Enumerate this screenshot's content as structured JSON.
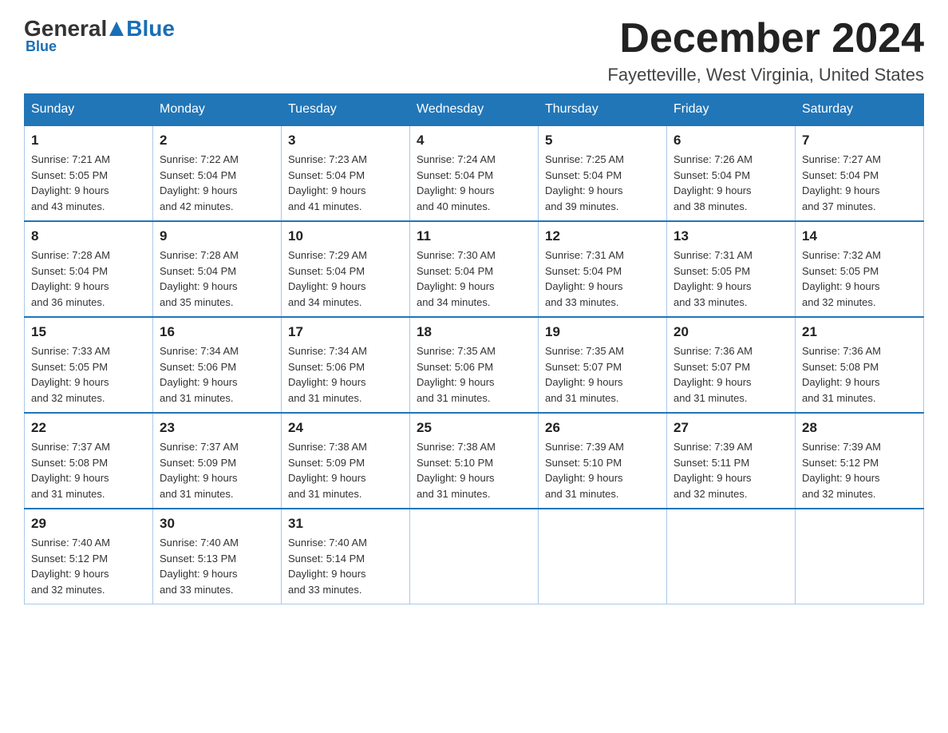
{
  "header": {
    "logo_general": "General",
    "logo_blue": "Blue",
    "month_title": "December 2024",
    "location": "Fayetteville, West Virginia, United States"
  },
  "days_of_week": [
    "Sunday",
    "Monday",
    "Tuesday",
    "Wednesday",
    "Thursday",
    "Friday",
    "Saturday"
  ],
  "weeks": [
    [
      {
        "day": "1",
        "sunrise": "7:21 AM",
        "sunset": "5:05 PM",
        "daylight": "9 hours and 43 minutes."
      },
      {
        "day": "2",
        "sunrise": "7:22 AM",
        "sunset": "5:04 PM",
        "daylight": "9 hours and 42 minutes."
      },
      {
        "day": "3",
        "sunrise": "7:23 AM",
        "sunset": "5:04 PM",
        "daylight": "9 hours and 41 minutes."
      },
      {
        "day": "4",
        "sunrise": "7:24 AM",
        "sunset": "5:04 PM",
        "daylight": "9 hours and 40 minutes."
      },
      {
        "day": "5",
        "sunrise": "7:25 AM",
        "sunset": "5:04 PM",
        "daylight": "9 hours and 39 minutes."
      },
      {
        "day": "6",
        "sunrise": "7:26 AM",
        "sunset": "5:04 PM",
        "daylight": "9 hours and 38 minutes."
      },
      {
        "day": "7",
        "sunrise": "7:27 AM",
        "sunset": "5:04 PM",
        "daylight": "9 hours and 37 minutes."
      }
    ],
    [
      {
        "day": "8",
        "sunrise": "7:28 AM",
        "sunset": "5:04 PM",
        "daylight": "9 hours and 36 minutes."
      },
      {
        "day": "9",
        "sunrise": "7:28 AM",
        "sunset": "5:04 PM",
        "daylight": "9 hours and 35 minutes."
      },
      {
        "day": "10",
        "sunrise": "7:29 AM",
        "sunset": "5:04 PM",
        "daylight": "9 hours and 34 minutes."
      },
      {
        "day": "11",
        "sunrise": "7:30 AM",
        "sunset": "5:04 PM",
        "daylight": "9 hours and 34 minutes."
      },
      {
        "day": "12",
        "sunrise": "7:31 AM",
        "sunset": "5:04 PM",
        "daylight": "9 hours and 33 minutes."
      },
      {
        "day": "13",
        "sunrise": "7:31 AM",
        "sunset": "5:05 PM",
        "daylight": "9 hours and 33 minutes."
      },
      {
        "day": "14",
        "sunrise": "7:32 AM",
        "sunset": "5:05 PM",
        "daylight": "9 hours and 32 minutes."
      }
    ],
    [
      {
        "day": "15",
        "sunrise": "7:33 AM",
        "sunset": "5:05 PM",
        "daylight": "9 hours and 32 minutes."
      },
      {
        "day": "16",
        "sunrise": "7:34 AM",
        "sunset": "5:06 PM",
        "daylight": "9 hours and 31 minutes."
      },
      {
        "day": "17",
        "sunrise": "7:34 AM",
        "sunset": "5:06 PM",
        "daylight": "9 hours and 31 minutes."
      },
      {
        "day": "18",
        "sunrise": "7:35 AM",
        "sunset": "5:06 PM",
        "daylight": "9 hours and 31 minutes."
      },
      {
        "day": "19",
        "sunrise": "7:35 AM",
        "sunset": "5:07 PM",
        "daylight": "9 hours and 31 minutes."
      },
      {
        "day": "20",
        "sunrise": "7:36 AM",
        "sunset": "5:07 PM",
        "daylight": "9 hours and 31 minutes."
      },
      {
        "day": "21",
        "sunrise": "7:36 AM",
        "sunset": "5:08 PM",
        "daylight": "9 hours and 31 minutes."
      }
    ],
    [
      {
        "day": "22",
        "sunrise": "7:37 AM",
        "sunset": "5:08 PM",
        "daylight": "9 hours and 31 minutes."
      },
      {
        "day": "23",
        "sunrise": "7:37 AM",
        "sunset": "5:09 PM",
        "daylight": "9 hours and 31 minutes."
      },
      {
        "day": "24",
        "sunrise": "7:38 AM",
        "sunset": "5:09 PM",
        "daylight": "9 hours and 31 minutes."
      },
      {
        "day": "25",
        "sunrise": "7:38 AM",
        "sunset": "5:10 PM",
        "daylight": "9 hours and 31 minutes."
      },
      {
        "day": "26",
        "sunrise": "7:39 AM",
        "sunset": "5:10 PM",
        "daylight": "9 hours and 31 minutes."
      },
      {
        "day": "27",
        "sunrise": "7:39 AM",
        "sunset": "5:11 PM",
        "daylight": "9 hours and 32 minutes."
      },
      {
        "day": "28",
        "sunrise": "7:39 AM",
        "sunset": "5:12 PM",
        "daylight": "9 hours and 32 minutes."
      }
    ],
    [
      {
        "day": "29",
        "sunrise": "7:40 AM",
        "sunset": "5:12 PM",
        "daylight": "9 hours and 32 minutes."
      },
      {
        "day": "30",
        "sunrise": "7:40 AM",
        "sunset": "5:13 PM",
        "daylight": "9 hours and 33 minutes."
      },
      {
        "day": "31",
        "sunrise": "7:40 AM",
        "sunset": "5:14 PM",
        "daylight": "9 hours and 33 minutes."
      },
      null,
      null,
      null,
      null
    ]
  ],
  "labels": {
    "sunrise": "Sunrise:",
    "sunset": "Sunset:",
    "daylight": "Daylight:"
  }
}
